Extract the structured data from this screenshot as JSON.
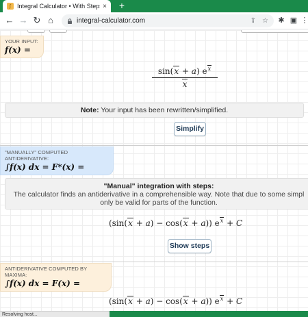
{
  "browser": {
    "tab_title": "Integral Calculator • With Steps!",
    "tab_close": "×",
    "new_tab": "+",
    "url": "integral-calculator.com",
    "status": "Resolving host...",
    "icons": [
      "back-arrow-icon",
      "forward-arrow-icon",
      "reload-icon",
      "home-icon",
      "lock-icon",
      "share-icon",
      "star-icon",
      "extensions-icon",
      "sidepanel-icon",
      "menu-icon"
    ]
  },
  "sections": {
    "input": {
      "label": "YOUR INPUT:",
      "formula": "f(x) ="
    },
    "note": {
      "bold": "Note:",
      "text": " Your input has been rewritten/simplified."
    },
    "simplify_button": "Simplify",
    "manual": {
      "label": "\"MANUALLY\" COMPUTED ANTIDERIVATIVE:",
      "formula": "∫f(x) dx = F*(x) ="
    },
    "steps_box": {
      "heading": "\"Manual\" integration with steps:",
      "line1": "The calculator finds an antiderivative in a comprehensible way. Note that due to some simpl",
      "line2": "only be valid for parts of the function."
    },
    "show_steps_button": "Show steps",
    "maxima": {
      "label": "ANTIDERIVATIVE COMPUTED BY MAXIMA:",
      "formula": "∫f(x) dx = F(x) ="
    }
  },
  "colors": {
    "chrome_green": "#1a8a4a",
    "input_header": "#fdf0dc",
    "manual_header": "#d7e8fb",
    "button_text": "#1f3b57"
  }
}
